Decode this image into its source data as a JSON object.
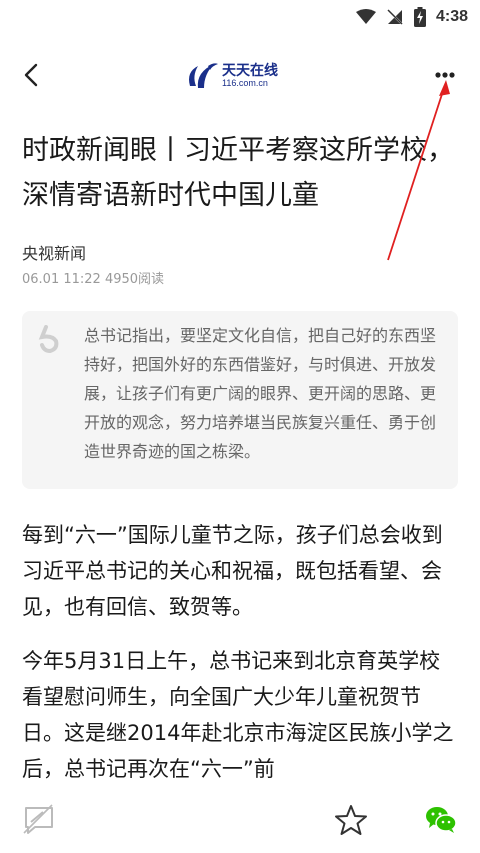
{
  "status_bar": {
    "time": "4:38"
  },
  "header": {
    "logo_text": "天天在线",
    "logo_sub": "116.com.cn"
  },
  "article": {
    "title": "时政新闻眼丨习近平考察这所学校，深情寄语新时代中国儿童",
    "source": "央视新闻",
    "meta": "06.01 11:22  4950阅读",
    "quote": "总书记指出，要坚定文化自信，把自己好的东西坚持好，把国外好的东西借鉴好，与时俱进、开放发展，让孩子们有更广阔的眼界、更开阔的思路、更开放的观念，努力培养堪当民族复兴重任、勇于创造世界奇迹的国之栋梁。",
    "paragraphs": [
      "每到“六一”国际儿童节之际，孩子们总会收到习近平总书记的关心和祝福，既包括看望、会见，也有回信、致贺等。",
      "今年5月31日上午，总书记来到北京育英学校看望慰问师生，向全国广大少年儿童祝贺节日。这是继2014年赴北京市海淀区民族小学之后，总书记再次在“六一”前"
    ]
  },
  "colors": {
    "logo_blue": "#1a2f8a",
    "wechat_green": "#2dc100",
    "annotation_red": "#e02020"
  }
}
